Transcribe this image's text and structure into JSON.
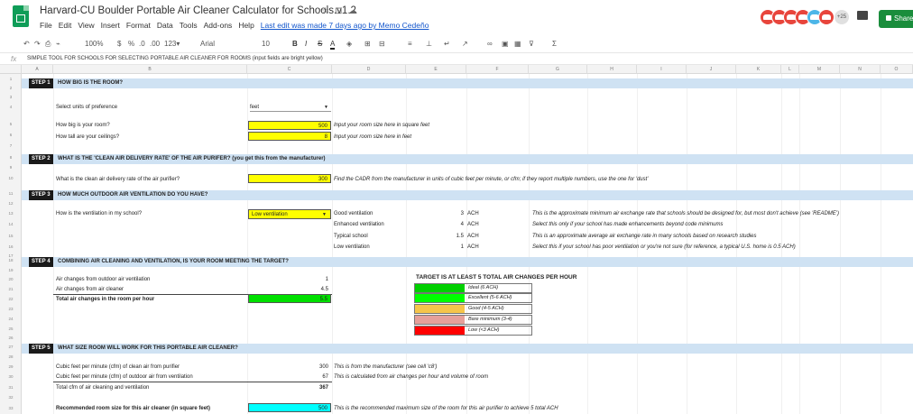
{
  "header": {
    "title": "Harvard-CU Boulder Portable Air Cleaner Calculator for Schools.v1.2",
    "menu": [
      "File",
      "Edit",
      "View",
      "Insert",
      "Format",
      "Data",
      "Tools",
      "Add-ons",
      "Help"
    ],
    "last_edit": "Last edit was made 7 days ago by Memo Cedeño",
    "collaborators_count": "+25",
    "share_label": "Share",
    "avatar_colors": [
      "#e8453c",
      "#e8453c",
      "#e8453c",
      "#e8453c",
      "#4db6e8",
      "#e8453c"
    ]
  },
  "toolbar": {
    "zoom": "100%",
    "currency": "$",
    "percent": "%",
    "dec0": ".0",
    "dec00": ".00",
    "numfmt": "123▾",
    "font": "Arial",
    "font_size": "10",
    "bold": "B",
    "italic": "I",
    "strike": "S",
    "textcolor": "A"
  },
  "formula_bar": {
    "fx": "fx",
    "content": "SIMPLE TOOL FOR SCHOOLS FOR SELECTING PORTABLE AIR CLEANER FOR ROOMS (input fields are bright yellow)"
  },
  "columns": [
    "A",
    "B",
    "C",
    "D",
    "E",
    "F",
    "G",
    "H",
    "I",
    "J",
    "K",
    "L",
    "M",
    "N",
    "O"
  ],
  "rows": [
    "1",
    "2",
    "3",
    "4",
    "5",
    "6",
    "7",
    "8",
    "9",
    "10",
    "11",
    "12",
    "13",
    "14",
    "15",
    "16",
    "17",
    "18",
    "19",
    "20",
    "21",
    "22",
    "23",
    "24",
    "25",
    "26",
    "27",
    "28",
    "29",
    "30",
    "31",
    "32",
    "33",
    "34"
  ],
  "step1": {
    "badge": "STEP 1",
    "title": "HOW BIG IS THE ROOM?",
    "units_label": "Select units of preference",
    "units_value": "feet",
    "size_label": "How big is your room?",
    "size_value": "500",
    "size_note": "Input your room size here in square feet",
    "ceiling_label": "How tall are your ceilings?",
    "ceiling_value": "8",
    "ceiling_note": "Input your room size here in feet"
  },
  "step2": {
    "badge": "STEP 2",
    "title": "WHAT IS THE 'CLEAN AIR DELIVERY RATE' OF THE AIR PURIFER? (you get this from the manufacturer)",
    "cadr_label": "What is the clean air delivery rate of the air purifier?",
    "cadr_value": "300",
    "cadr_note": "Find the CADR from the manufacturer in units of cubic feet per minute, or cfm; if they report multiple numbers, use the one for 'dust'"
  },
  "step3": {
    "badge": "STEP 3",
    "title": "HOW MUCH OUTDOOR AIR VENTILATION DO YOU HAVE?",
    "vent_label": "How is the ventilation in my school?",
    "vent_value": "Low ventilation",
    "options": [
      {
        "name": "Good ventilation",
        "ach": "3",
        "unit": "ACH",
        "note": "This is the approximate minimum air exchange rate that schools should be designed for, but most don't achieve (see 'README')"
      },
      {
        "name": "Enhanced ventilation",
        "ach": "4",
        "unit": "ACH",
        "note": "Select this only if your school has made enhancements beyond code minimums"
      },
      {
        "name": "Typical school",
        "ach": "1.5",
        "unit": "ACH",
        "note": "This is an approximate average air exchange rate in many schools based on research studies"
      },
      {
        "name": "Low ventilation",
        "ach": "1",
        "unit": "ACH",
        "note": "Select this if your school has poor ventilation or you're not sure (for reference, a typical U.S. home is 0.5 ACH)"
      }
    ]
  },
  "step4": {
    "badge": "STEP 4",
    "title": "COMBINING AIR CLEANING AND VENTILATION, IS YOUR ROOM MEETING THE TARGET?",
    "outdoor_label": "Air changes from outdoor air ventilation",
    "outdoor_value": "1",
    "cleaner_label": "Air changes from air cleaner",
    "cleaner_value": "4.5",
    "total_label": "Total air changes in the room per hour",
    "total_value": "5.5",
    "target_title": "TARGET IS AT LEAST 5 TOTAL AIR CHANGES PER HOUR",
    "legend": [
      {
        "label": "Ideal (6 ACH)",
        "color": "#00d000"
      },
      {
        "label": "Excellent (5-6 ACH)",
        "color": "#00ff00"
      },
      {
        "label": "Good (4-5 ACH)",
        "color": "#f6c54a"
      },
      {
        "label": "Bare minimum (3-4)",
        "color": "#e6a09a"
      },
      {
        "label": "Low (<3 ACH)",
        "color": "#ff0000"
      }
    ]
  },
  "step5": {
    "badge": "STEP 5",
    "title": "WHAT SIZE ROOM WILL WORK FOR THIS PORTABLE AIR CLEANER?",
    "cfm_clean_label": "Cubic feet per minute (cfm) of clean air from purifier",
    "cfm_clean_value": "300",
    "cfm_clean_note": "This is from the manufacturer (see cell 'c8')",
    "cfm_out_label": "Cubic feet per minute (cfm) of outdoor air from ventilation",
    "cfm_out_value": "67",
    "cfm_out_note": "This is calculated from air changes per hour and volume of room",
    "total_cfm_label": "Total cfm of air cleaning and ventilation",
    "total_cfm_value": "367",
    "rec_label": "Recommended room size for this air cleaner (in square feet)",
    "rec_value": "500",
    "rec_note": "This is the recommended maximum size of the room for this air purifier to achieve 5 total ACH"
  }
}
